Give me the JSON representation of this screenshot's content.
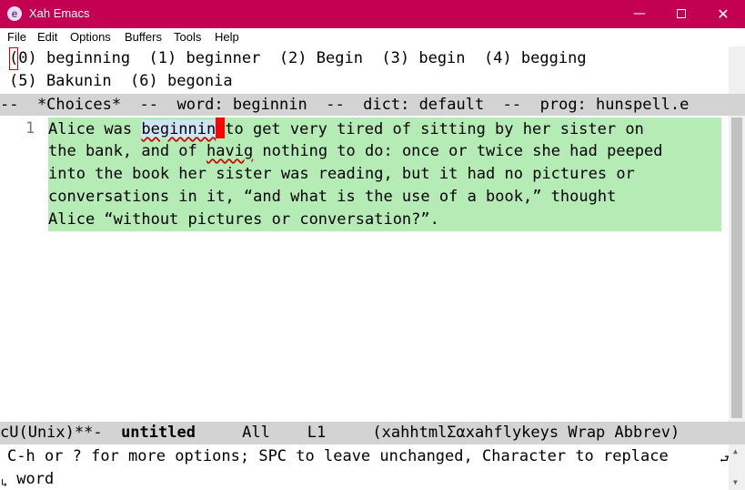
{
  "window": {
    "title": "Xah Emacs",
    "icon": "emacs-icon",
    "minimize": "—",
    "close": "✕",
    "accent": "#c30052"
  },
  "menu": [
    "File",
    "Edit",
    "Options",
    "Buffers",
    "Tools",
    "Help"
  ],
  "choices": {
    "cursor_char": "(",
    "line1_rest": "0) beginning  (1) beginner  (2) Begin  (3) begin  (4) begging",
    "line2": "(5) Bakunin  (6) begonia"
  },
  "modeline_top": "--  *Choices*  --  word: beginnin  --  dict: default  --  prog: hunspell.e",
  "buffer": {
    "line_number": "1",
    "line1_before": "Alice was ",
    "line1_word": "beginnin",
    "line1_after": "to get very tired of sitting by her sister on",
    "line2_before": "the bank, and of ",
    "line2_miss": "havig",
    "line2_after": " nothing to do: once or twice she had peeped",
    "line3": "into the book her sister was reading, but it had no pictures or",
    "line4": "conversations in it, “and what is the use of a book,” thought",
    "line5": "Alice “without pictures or conversation?”."
  },
  "modeline_bottom": {
    "status": "cU(Unix)**-  ",
    "buffer_name": "untitled",
    "position": "     All    L1     ",
    "modes": "(xahhtmlΣαxahflykeys Wrap Abbrev)"
  },
  "minibuffer": {
    "line1": "C-h or ? for more options; SPC to leave unchanged, Character to replace",
    "line2": " word",
    "wrap_right": "⮐",
    "wrap_left": "↳"
  },
  "colors": {
    "region": "#b5ebb5",
    "modeline": "#d3d3d3",
    "cursor": "#ff0000",
    "word_highlight": "#cde5f7"
  }
}
